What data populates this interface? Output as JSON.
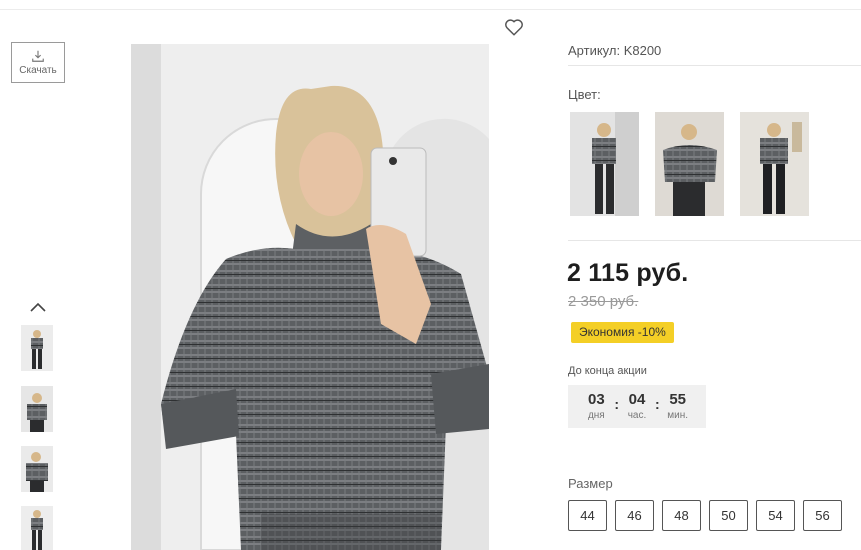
{
  "product": {
    "article": "Артикул: K8200",
    "color_label": "Цвет:",
    "price": "2 115 руб.",
    "old_price": "2 350 руб.",
    "discount_badge": "Экономия -10%",
    "promo_label": "До конца акции",
    "size_label": "Размер",
    "sizes": [
      "44",
      "46",
      "48",
      "50",
      "54",
      "56"
    ]
  },
  "gallery": {
    "download_label": "Скачать",
    "thumbnail_count": 4,
    "color_swatch_count": 3
  },
  "timer": {
    "days": "03",
    "days_unit": "дня",
    "hours": "04",
    "hours_unit": "час.",
    "minutes": "55",
    "minutes_unit": "мин."
  },
  "icons": {
    "favorite": "heart-icon",
    "download": "download-icon",
    "scroll_up": "chevron-up-icon"
  },
  "colors": {
    "discount_bg": "#f4cf26",
    "price_text": "#1e1e1e",
    "old_price_text": "#9a9a9a",
    "timer_bg": "#f0f0f0"
  }
}
